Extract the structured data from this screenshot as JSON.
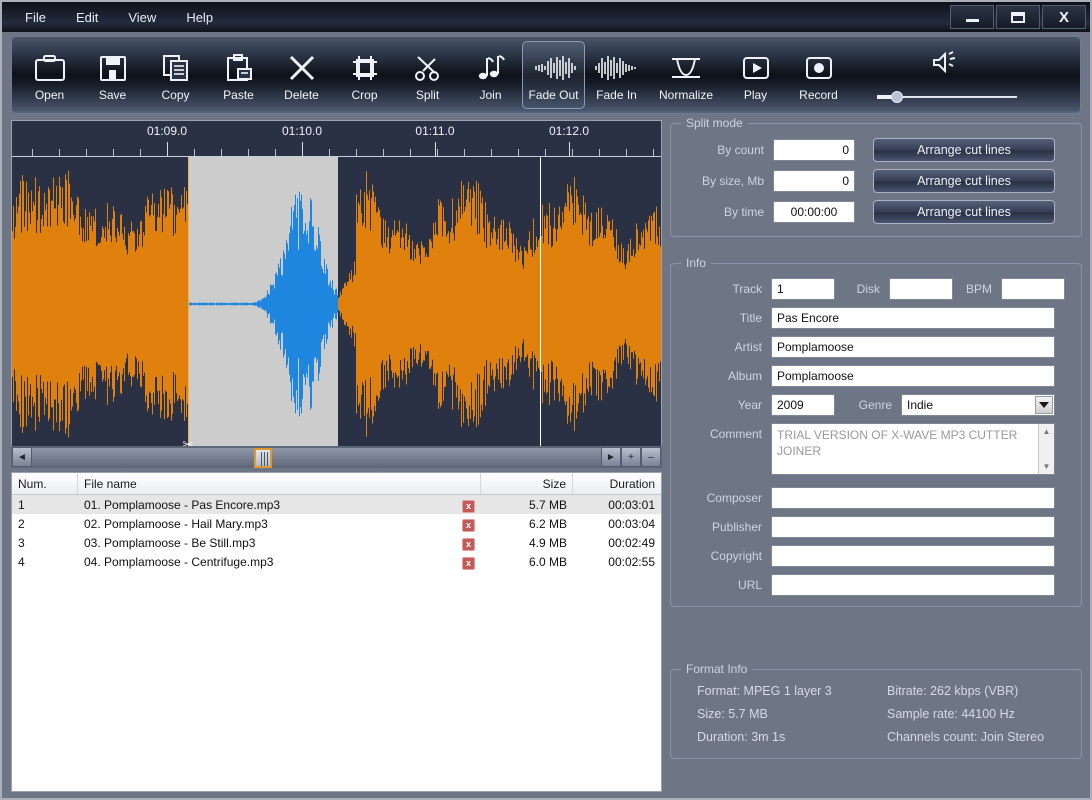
{
  "window": {
    "minimize_label": "–",
    "maximize_label": "▭",
    "close_label": "X"
  },
  "menubar": {
    "items": [
      {
        "label": "File"
      },
      {
        "label": "Edit"
      },
      {
        "label": "View"
      },
      {
        "label": "Help"
      }
    ]
  },
  "toolbar": {
    "buttons": [
      {
        "label": "Open",
        "icon": "folder-icon",
        "active": false
      },
      {
        "label": "Save",
        "icon": "floppy-icon",
        "active": false
      },
      {
        "label": "Copy",
        "icon": "copy-icon",
        "active": false
      },
      {
        "label": "Paste",
        "icon": "clipboard-icon",
        "active": false
      },
      {
        "label": "Delete",
        "icon": "x-cross-icon",
        "active": false
      },
      {
        "label": "Crop",
        "icon": "crop-icon",
        "active": false
      },
      {
        "label": "Split",
        "icon": "scissors-icon",
        "active": false
      },
      {
        "label": "Join",
        "icon": "notes-icon",
        "active": false
      },
      {
        "label": "Fade Out",
        "icon": "fade-out-icon",
        "active": true
      },
      {
        "label": "Fade In",
        "icon": "fade-in-icon",
        "active": false
      },
      {
        "label": "Normalize",
        "icon": "normalize-icon",
        "active": false
      },
      {
        "label": "Play",
        "icon": "play-icon",
        "active": false
      },
      {
        "label": "Record",
        "icon": "record-icon",
        "active": false
      }
    ],
    "volume": {
      "icon": "speaker-icon",
      "value_pct": 11
    }
  },
  "waveform": {
    "time_labels": [
      "01:09.0",
      "01:10.0",
      "01:11.0",
      "01:12.0"
    ],
    "selection_start_pct": 27.1,
    "selection_end_pct": 50.2,
    "cut_marker_label": "x",
    "scissors_glyph": "✂",
    "playhead_pct": 81.3,
    "wave_color": "#e0810e",
    "selected_wave_color": "#1f86e0",
    "background_color": "#2b3145",
    "selection_color": "#cccccc"
  },
  "hscroll": {
    "left_arrow": "◄",
    "right_arrow": "►",
    "zoom_in": "+",
    "zoom_out": "–"
  },
  "filelist": {
    "columns": [
      "Num.",
      "File name",
      "Size",
      "Duration"
    ],
    "delete_glyph": "x",
    "rows": [
      {
        "num": "1",
        "name": "01. Pomplamoose - Pas Encore.mp3",
        "size": "5.7 MB",
        "duration": "00:03:01",
        "selected": true
      },
      {
        "num": "2",
        "name": "02. Pomplamoose - Hail Mary.mp3",
        "size": "6.2 MB",
        "duration": "00:03:04",
        "selected": false
      },
      {
        "num": "3",
        "name": "03. Pomplamoose - Be Still.mp3",
        "size": "4.9 MB",
        "duration": "00:02:49",
        "selected": false
      },
      {
        "num": "4",
        "name": "04. Pomplamoose - Centrifuge.mp3",
        "size": "6.0 MB",
        "duration": "00:02:55",
        "selected": false
      }
    ]
  },
  "split_mode": {
    "legend": "Split mode",
    "by_count_label": "By count",
    "by_count_value": "0",
    "by_size_label": "By size, Mb",
    "by_size_value": "0",
    "by_time_label": "By time",
    "by_time_value": "00:00:00",
    "arrange_label_1": "Arrange cut lines",
    "arrange_label_2": "Arrange cut lines",
    "arrange_label_3": "Arrange cut lines"
  },
  "info": {
    "legend": "Info",
    "track_label": "Track",
    "track_value": "1",
    "disk_label": "Disk",
    "disk_value": "",
    "bpm_label": "BPM",
    "bpm_value": "",
    "title_label": "Title",
    "title_value": "Pas Encore",
    "artist_label": "Artist",
    "artist_value": "Pomplamoose",
    "album_label": "Album",
    "album_value": "Pomplamoose",
    "year_label": "Year",
    "year_value": "2009",
    "genre_label": "Genre",
    "genre_value": "Indie",
    "comment_label": "Comment",
    "comment_value": "TRIAL VERSION OF X-WAVE MP3 CUTTER JOINER",
    "composer_label": "Composer",
    "composer_value": "",
    "publisher_label": "Publisher",
    "publisher_value": "",
    "copyright_label": "Copyright",
    "copyright_value": "",
    "url_label": "URL",
    "url_value": "",
    "scroll_up": "▲",
    "scroll_down": "▼"
  },
  "format_info": {
    "legend": "Format Info",
    "format": "Format: MPEG 1 layer 3",
    "bitrate": "Bitrate: 262 kbps (VBR)",
    "size": "Size: 5.7 MB",
    "sample_rate": "Sample rate: 44100 Hz",
    "duration": "Duration: 3m 1s",
    "channels": "Channels count: Join Stereo"
  }
}
